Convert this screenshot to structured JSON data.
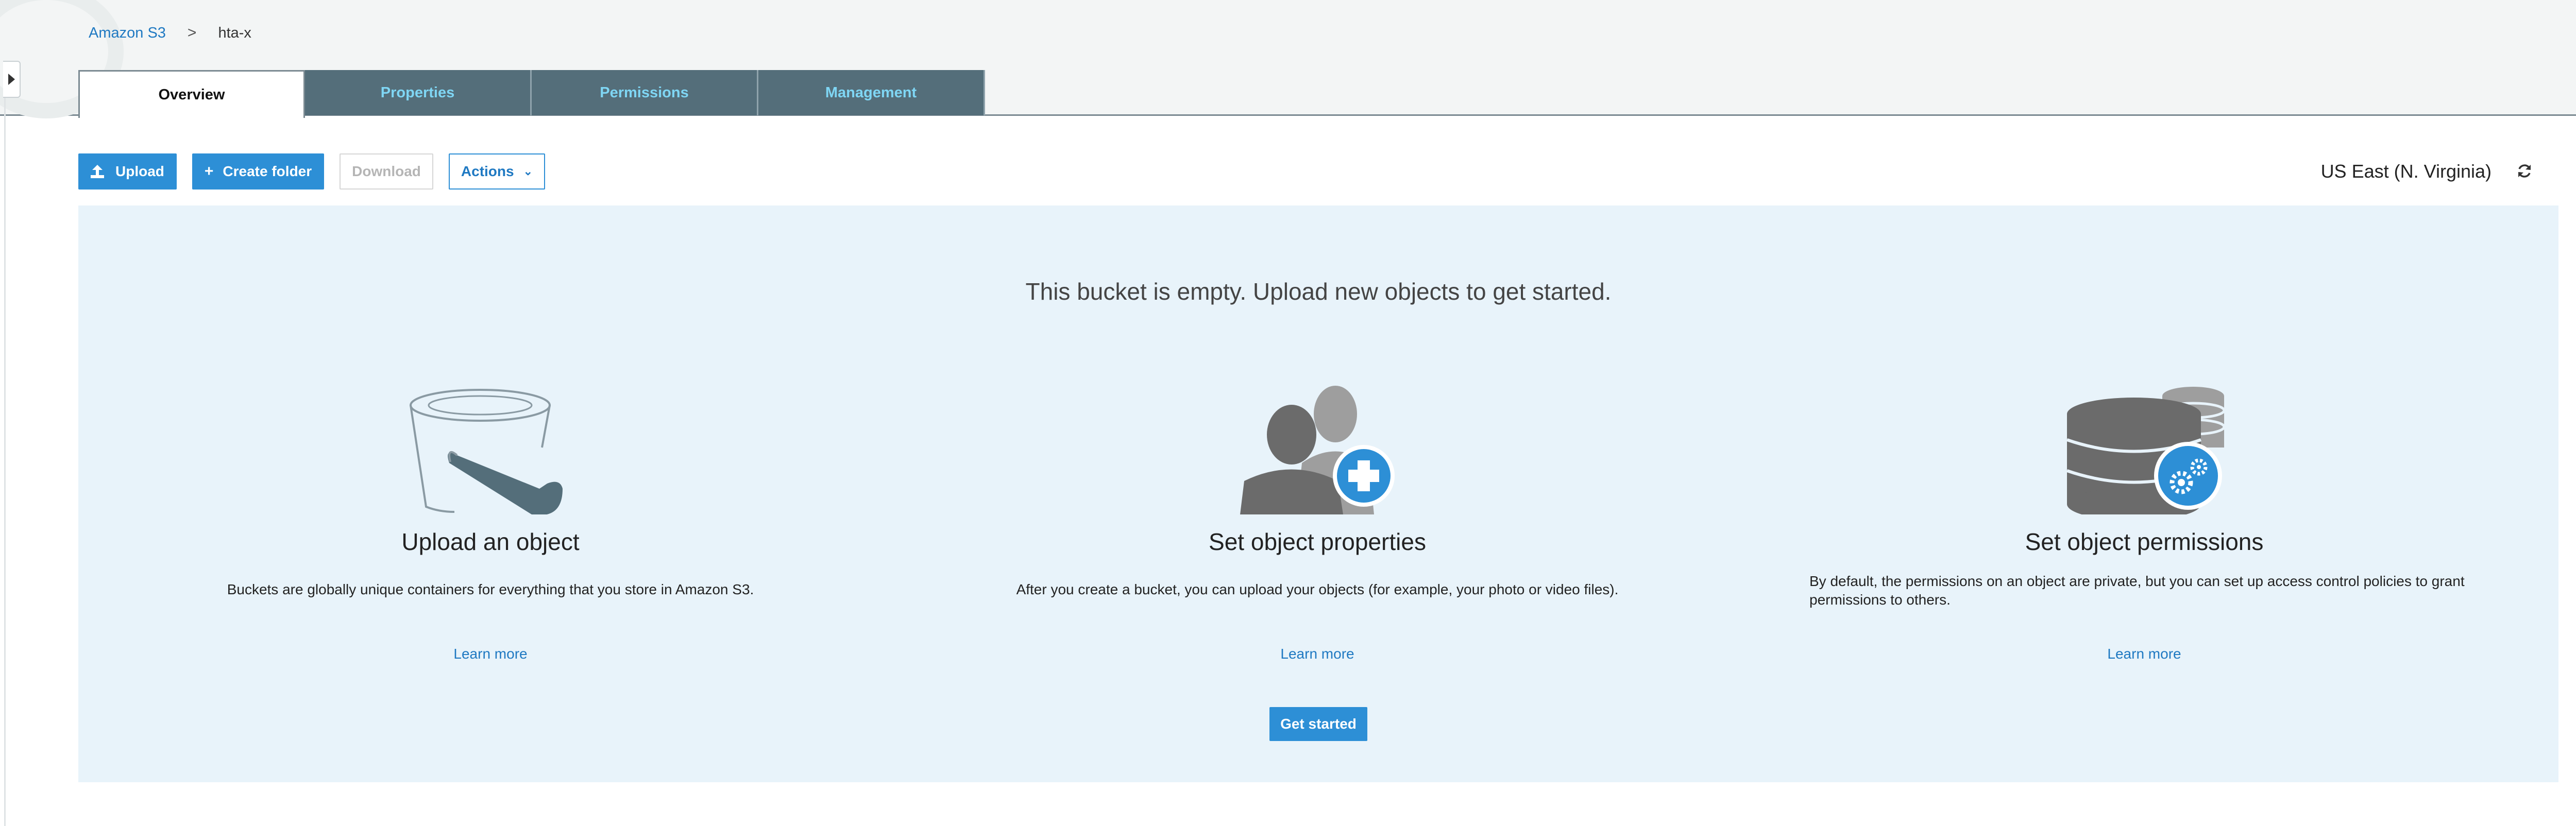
{
  "breadcrumb": {
    "root": "Amazon S3",
    "separator": ">",
    "current": "hta-x"
  },
  "tabs": [
    {
      "label": "Overview",
      "active": true
    },
    {
      "label": "Properties",
      "active": false
    },
    {
      "label": "Permissions",
      "active": false
    },
    {
      "label": "Management",
      "active": false
    }
  ],
  "toolbar": {
    "upload_label": "Upload",
    "create_folder_label": "Create folder",
    "download_label": "Download",
    "actions_label": "Actions"
  },
  "region": {
    "label": "US East (N. Virginia)"
  },
  "empty_state": {
    "title": "This bucket is empty. Upload new objects to get started.",
    "columns": [
      {
        "icon": "bucket-icon",
        "heading": "Upload an object",
        "text": "Buckets are globally unique containers for everything that you store in Amazon S3.",
        "link": "Learn more"
      },
      {
        "icon": "users-add-icon",
        "heading": "Set object properties",
        "text": "After you create a bucket, you can upload your objects (for example, your photo or video files).",
        "link": "Learn more"
      },
      {
        "icon": "database-settings-icon",
        "heading": "Set object permissions",
        "text": "By default, the permissions on an object are private, but you can set up access control policies to grant permissions to others.",
        "link": "Learn more"
      }
    ],
    "cta_label": "Get started"
  },
  "colors": {
    "primary": "#2d8fd6",
    "link": "#1f79c2",
    "tab_bg": "#546e7a",
    "tab_text": "#7fd6f4",
    "panel_bg": "#e8f3fa"
  }
}
